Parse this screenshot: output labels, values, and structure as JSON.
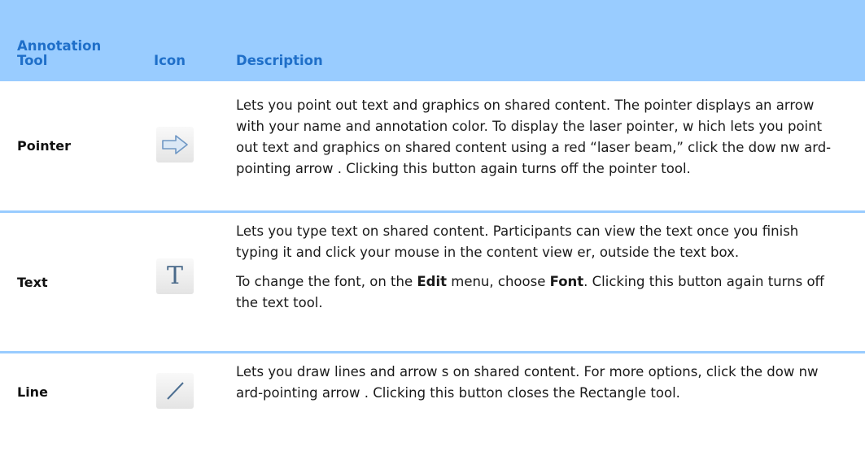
{
  "header": {
    "tool": "Annotation Tool",
    "icon": "Icon",
    "description": "Description"
  },
  "rows": [
    {
      "tool": "Pointer",
      "icon": "right-arrow-icon",
      "description": "Lets you point out text and graphics on shared content. The pointer displays an arrow with your name and annotation color. To display the laser pointer, w hich lets you point out text and graphics on shared content using a red “laser beam,” click the dow nw ard-pointing arrow . Clicking this button again turns off the pointer tool."
    },
    {
      "tool": "Text",
      "icon": "text-T-icon",
      "description": "Lets you type text on shared content. Participants can view the text once you finish typing it and click your mouse in the content view er, outside the text box.",
      "note": {
        "p1": "To change the font, on the ",
        "edit": "Edit",
        "p2": " menu, choose ",
        "font": "Font",
        "p3": ". Clicking this button again turns off the text tool."
      }
    },
    {
      "tool": "Line",
      "icon": "line-icon",
      "description": "Lets you draw lines and arrow s on shared content. For more options, click the dow nw ard-pointing arrow . Clicking this button closes the Rectangle tool."
    }
  ],
  "colors": {
    "header_bg": "#99ccff",
    "header_text": "#1f6fc9",
    "divider": "#99ccff"
  }
}
